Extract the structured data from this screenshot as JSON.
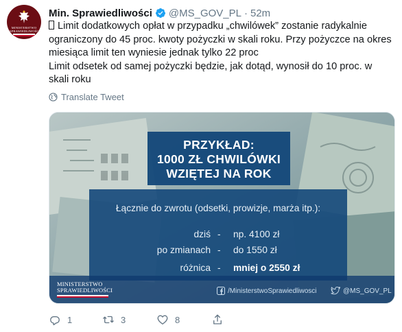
{
  "avatar": {
    "text": "MINISTERSTWO SPRAWIEDLIWOŚCI"
  },
  "header": {
    "name": "Min. Sprawiedliwości",
    "handle": "@MS_GOV_PL",
    "separator": "·",
    "time": "52m"
  },
  "tweet": {
    "lines": [
      "Limit dodatkowych opłat w przypadku „chwilówek” zostanie radykalnie ograniczony do 45 proc. kwoty pożyczki w skali roku. Przy pożyczce na okres miesiąca limit ten wyniesie jednak tylko 22 proc",
      "Limit odsetek od samej pożyczki będzie, jak dotąd, wynosił do 10 proc. w skali roku"
    ]
  },
  "translate": {
    "label": "Translate Tweet",
    "icon": "globe-icon"
  },
  "media": {
    "title_lines": [
      "PRZYKŁAD:",
      "1000 ZŁ CHWILÓWKI",
      "WZIĘTEJ NA ROK"
    ],
    "info_title": "Łącznie do zwrotu (odsetki, prowizje, marża itp.):",
    "rows": [
      {
        "label": "dziś",
        "sep": "-",
        "value": "np. 4100 zł"
      },
      {
        "label": "po zmianach",
        "sep": "-",
        "value": "do 1550 zł"
      },
      {
        "label": "różnica",
        "sep": "-",
        "value": "mniej o 2550 zł"
      }
    ],
    "logo_lines": [
      "MINISTERSTWO",
      "SPRAWIEDLIWOŚCI"
    ],
    "facebook": "/MinisterstwoSprawiedliwosci",
    "twitter": "@MS_GOV_PL"
  },
  "actions": {
    "reply_count": "1",
    "retweet_count": "3",
    "like_count": "8"
  },
  "colors": {
    "text": "#14171a",
    "muted": "#657786",
    "verified": "#1da1f2",
    "infographic_blue": "#14487a",
    "ministry_red": "#c8102e"
  }
}
